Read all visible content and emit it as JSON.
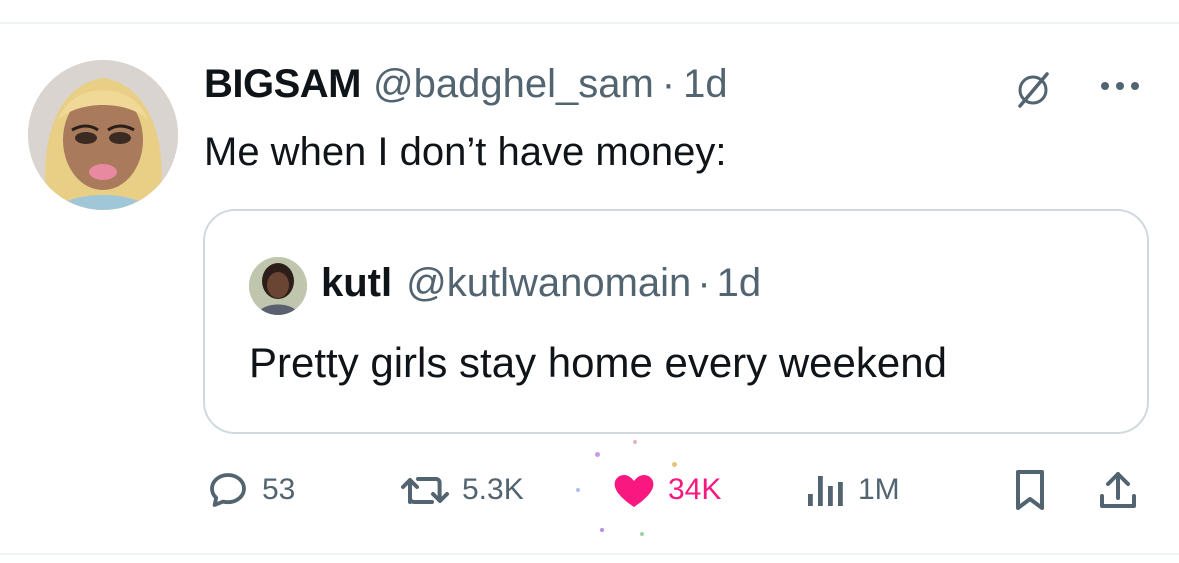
{
  "tweet": {
    "author_name": "BIGSAM",
    "author_handle": "@badghel_sam",
    "separator": "·",
    "time": "1d",
    "text": "Me when I don’t have money:"
  },
  "quoted": {
    "author_name": "kutl",
    "author_handle": "@kutlwanomain",
    "separator": "·",
    "time": "1d",
    "text": "Pretty girls stay home every weekend"
  },
  "actions": {
    "replies": "53",
    "reposts": "5.3K",
    "likes": "34K",
    "views": "1M"
  },
  "icons": {
    "grok": "grok-icon",
    "more": "more-dots-icon",
    "reply": "reply-bubble-icon",
    "repost": "repost-arrows-icon",
    "like": "heart-icon",
    "views": "views-bar-chart-icon",
    "bookmark": "bookmark-icon",
    "share": "share-upload-icon"
  },
  "colors": {
    "text": "#0f1419",
    "secondary": "#536471",
    "like_active": "#f91880",
    "border": "#cfd9de"
  }
}
